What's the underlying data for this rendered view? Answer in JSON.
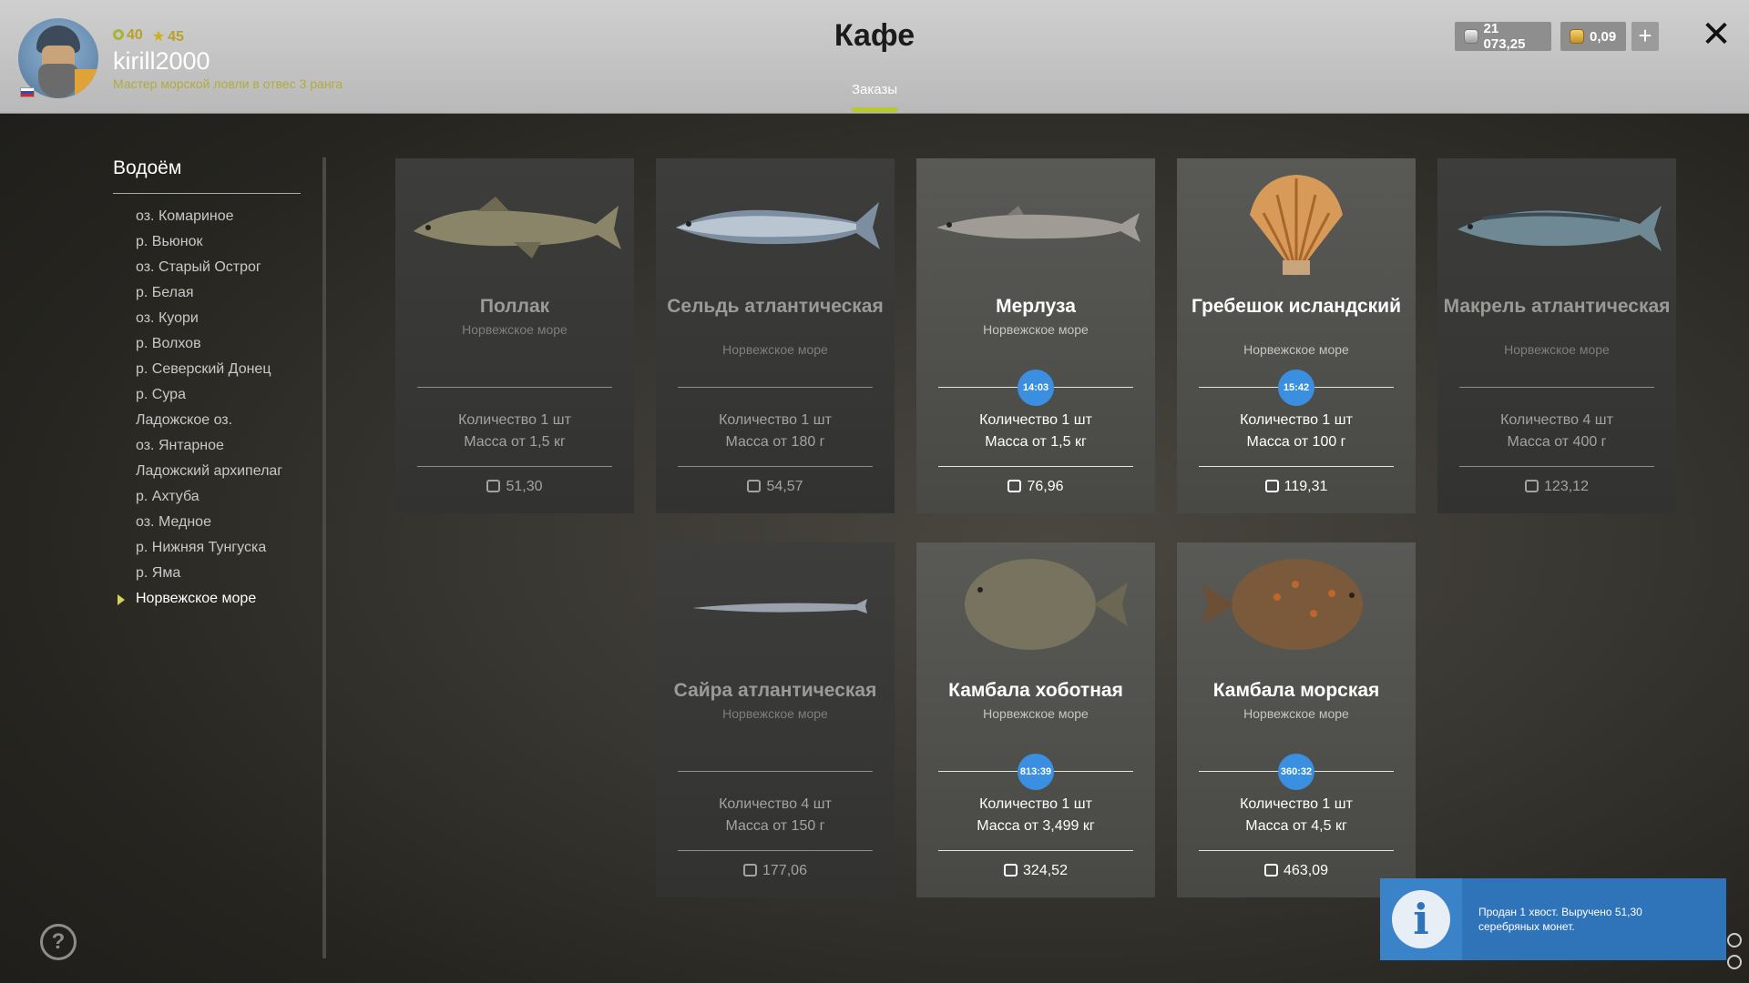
{
  "header": {
    "level": "40",
    "stars": "45",
    "username": "kirill2000",
    "rank": "Мастер морской ловли в отвес 3 ранга",
    "title": "Кафе",
    "tab": "Заказы",
    "silver": "21 073,25",
    "gold": "0,09",
    "plus": "+",
    "close": "✕"
  },
  "sidebar": {
    "title": "Водоём",
    "items": [
      {
        "label": "оз. Комариное"
      },
      {
        "label": "р. Вьюнок"
      },
      {
        "label": "оз. Старый Острог"
      },
      {
        "label": "р. Белая"
      },
      {
        "label": "оз. Куори"
      },
      {
        "label": "р. Волхов"
      },
      {
        "label": "р. Северский Донец"
      },
      {
        "label": "р. Сура"
      },
      {
        "label": "Ладожское оз."
      },
      {
        "label": "оз. Янтарное"
      },
      {
        "label": "Ладожский архипелаг"
      },
      {
        "label": "р. Ахтуба"
      },
      {
        "label": "оз. Медное"
      },
      {
        "label": "р. Нижняя Тунгуска"
      },
      {
        "label": "р. Яма"
      },
      {
        "label": "Норвежское море"
      }
    ],
    "selected": "Норвежское море"
  },
  "help": "?",
  "orders": [
    {
      "name": "Поллак",
      "location": "Норвежское море",
      "quantity": "Количество 1 шт",
      "mass": "Масса от 1,5 кг",
      "price": "51,30",
      "timer": ""
    },
    {
      "name": "Сельдь атлантическая",
      "location": "Норвежское море",
      "quantity": "Количество 1 шт",
      "mass": "Масса от 180 г",
      "price": "54,57",
      "timer": ""
    },
    {
      "name": "Мерлуза",
      "location": "Норвежское море",
      "quantity": "Количество 1 шт",
      "mass": "Масса от 1,5 кг",
      "price": "76,96",
      "timer": "14:03"
    },
    {
      "name": "Гребешок исландский",
      "location": "Норвежское море",
      "quantity": "Количество 1 шт",
      "mass": "Масса от 100 г",
      "price": "119,31",
      "timer": "15:42"
    },
    {
      "name": "Макрель атлантическая",
      "location": "Норвежское море",
      "quantity": "Количество 4 шт",
      "mass": "Масса от 400 г",
      "price": "123,12",
      "timer": ""
    },
    {
      "name": "Сайра атлантическая",
      "location": "Норвежское море",
      "quantity": "Количество 4 шт",
      "mass": "Масса от 150 г",
      "price": "177,06",
      "timer": ""
    },
    {
      "name": "Камбала хоботная",
      "location": "Норвежское море",
      "quantity": "Количество 1 шт",
      "mass": "Масса от 3,499 кг",
      "price": "324,52",
      "timer": "813:39"
    },
    {
      "name": "Камбала морская",
      "location": "Норвежское море",
      "quantity": "Количество 1 шт",
      "mass": "Масса от 4,5 кг",
      "price": "463,09",
      "timer": "360:32"
    }
  ],
  "notification": {
    "icon": "i",
    "text": "Продан 1 хвост. Выручено 51,30 серебряных монет."
  },
  "colors": {
    "accent": "#b5c928",
    "timer": "#3b8fe0",
    "notice": "#2f73b8"
  }
}
